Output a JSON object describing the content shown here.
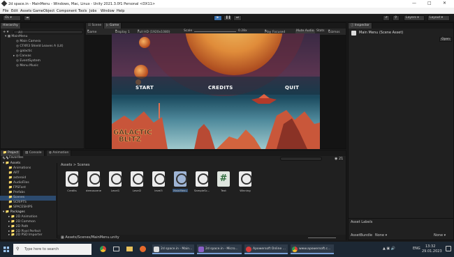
{
  "window": {
    "title": "2d space.in - MainMenu - Windows, Mac, Linux - Unity 2021.3.0f1 Personal <DX11>"
  },
  "menu": [
    "File",
    "Edit",
    "Assets",
    "GameObject",
    "Component",
    "Tools",
    "Jobs",
    "Window",
    "Help"
  ],
  "toolbar": {
    "account": "OL",
    "layers": "Layers",
    "layout": "Layout"
  },
  "hierarchy": {
    "tab": "Hierarchy",
    "search_placeholder": "All",
    "items": [
      "MainMenu",
      "Main Camera",
      "CFXR3 Shield Leaves A (Lit)",
      "galactic",
      "Canvas",
      "EventSystem",
      "Menu Music"
    ]
  },
  "scene_tabs": {
    "scene": "Scene",
    "game": "Game"
  },
  "gamebar": {
    "mode": "Game",
    "display": "Display 1",
    "resolution": "Full HD (1920x1080)",
    "scale_label": "Scale",
    "scale_value": "0.28x",
    "play_focused": "Play Focused",
    "mute": "Mute Audio",
    "stats": "Stats",
    "gizmos": "Gizmos"
  },
  "game_view": {
    "buttons": [
      "START",
      "CREDITS",
      "QUIT"
    ],
    "logo_line1": "GALACTIC",
    "logo_line2": "BLITZ"
  },
  "inspector": {
    "tab": "Inspector",
    "asset": "Main Menu (Scene Asset)",
    "open": "Open",
    "labels": "Asset Labels",
    "bundle": "AssetBundle",
    "bundle_value": "None",
    "variant_value": "None"
  },
  "bottom_tabs": [
    "Project",
    "Console",
    "Animation"
  ],
  "project": {
    "tree": [
      {
        "label": "Favorites",
        "indent": 0
      },
      {
        "label": "Assets",
        "indent": 0
      },
      {
        "label": "Animations",
        "indent": 1
      },
      {
        "label": "ART",
        "indent": 1
      },
      {
        "label": "asteroid",
        "indent": 1
      },
      {
        "label": "AudioFiles",
        "indent": 1
      },
      {
        "label": "FPSFont",
        "indent": 1
      },
      {
        "label": "Prefabs",
        "indent": 1
      },
      {
        "label": "Scenes",
        "indent": 1
      },
      {
        "label": "SCRIPTS",
        "indent": 1
      },
      {
        "label": "SPACESHIPS",
        "indent": 1
      },
      {
        "label": "Packages",
        "indent": 0
      },
      {
        "label": "2D Animation",
        "indent": 1
      },
      {
        "label": "2D Common",
        "indent": 1
      },
      {
        "label": "2D Path",
        "indent": 1
      },
      {
        "label": "2D Pixel Perfect",
        "indent": 1
      },
      {
        "label": "2D PSD Importer",
        "indent": 1
      },
      {
        "label": "2D Sprite",
        "indent": 1
      }
    ],
    "breadcrumb": "Assets > Scenes",
    "assets": [
      "Credits",
      "demoscene",
      "Level1",
      "Level2",
      "level3",
      "MainMenu",
      "SampleSc...",
      "Text",
      "Winning"
    ],
    "selected": "MainMenu",
    "path": "Assets/Scenes/MainMenu.unity",
    "count": "21"
  },
  "taskbar": {
    "search_placeholder": "Type here to search",
    "tasks": [
      "2d space.in - Main...",
      "2d space.in - Micro...",
      "Apowersoft Online ...",
      "www.apowersoft.c..."
    ],
    "lang": "ENG",
    "time": "13:32",
    "date": "29.01.2023"
  }
}
